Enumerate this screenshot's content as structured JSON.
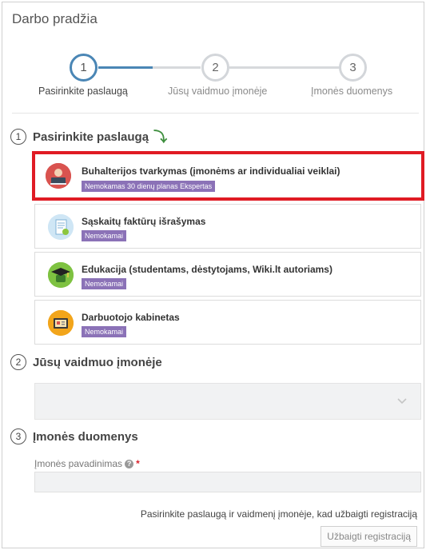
{
  "page": {
    "title": "Darbo pradžia"
  },
  "stepper": {
    "steps": [
      {
        "number": "1",
        "label": "Pasirinkite paslaugą"
      },
      {
        "number": "2",
        "label": "Jūsų vaidmuo įmonėje"
      },
      {
        "number": "3",
        "label": "Įmonės duomenys"
      }
    ],
    "active_step": 1
  },
  "sections": {
    "services": {
      "number": "1",
      "title": "Pasirinkite paslaugą",
      "arrow_icon": "down-arrow-icon"
    },
    "role": {
      "number": "2",
      "title": "Jūsų vaidmuo įmonėje"
    },
    "company": {
      "number": "3",
      "title": "Įmonės duomenys"
    }
  },
  "services": [
    {
      "name": "Buhalterijos tvarkymas (įmonėms ar individualiai veiklai)",
      "badge": "Nemokamas 30 dienų planas Ekspertas",
      "icon": "accountant-icon",
      "selected": true
    },
    {
      "name": "Sąskaitų faktūrų išrašymas",
      "badge": "Nemokamai",
      "icon": "invoice-icon",
      "selected": false
    },
    {
      "name": "Edukacija (studentams, dėstytojams, Wiki.lt autoriams)",
      "badge": "Nemokamai",
      "icon": "graduation-cap-icon",
      "selected": false
    },
    {
      "name": "Darbuotojo kabinetas",
      "badge": "Nemokamai",
      "icon": "employee-cabinet-icon",
      "selected": false
    }
  ],
  "role_select": {
    "value": ""
  },
  "company_form": {
    "name_label": "Įmonės pavadinimas",
    "required_mark": "*",
    "help_mark": "?",
    "name_value": ""
  },
  "footer": {
    "hint": "Pasirinkite paslaugą ir vaidmenį įmonėje, kad užbaigti registraciją",
    "finish_label": "Užbaigti registraciją"
  },
  "colors": {
    "accent": "#4a86b5",
    "badge": "#8b72b7",
    "selection_border": "#e01b24",
    "required": "#d9232d"
  }
}
